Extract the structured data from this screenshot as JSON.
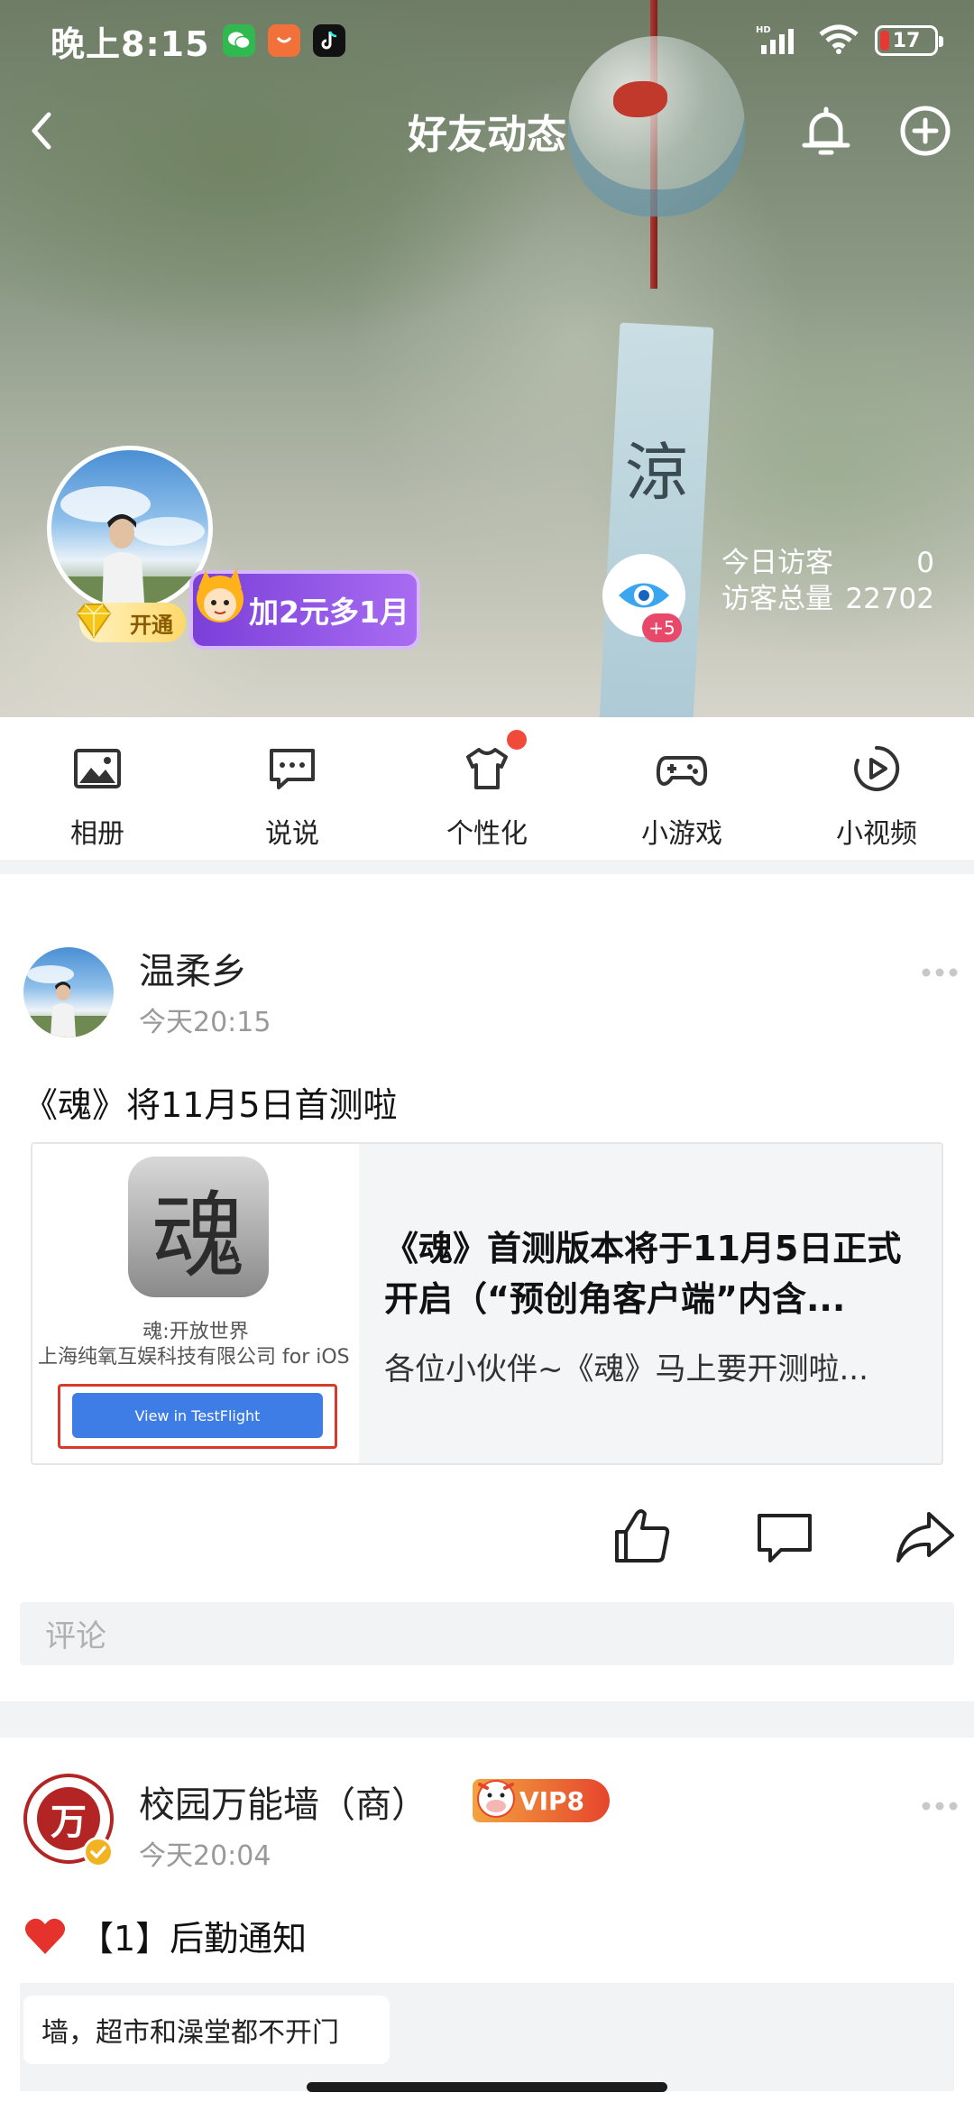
{
  "status_bar": {
    "time": "晚上8:15",
    "network": "HD",
    "battery": "17"
  },
  "nav": {
    "title": "好友动态"
  },
  "cover": {
    "chime_char": "涼",
    "open_badge": "开通",
    "promo": "加2元多1月",
    "visitor_plus": "+5",
    "visitors_today_label": "今日访客",
    "visitors_today": "0",
    "visitors_total_label": "访客总量",
    "visitors_total": "22702"
  },
  "functions": [
    {
      "label": "相册",
      "icon": "photo-album-icon"
    },
    {
      "label": "说说",
      "icon": "message-bubble-icon"
    },
    {
      "label": "个性化",
      "icon": "tshirt-icon",
      "has_dot": true
    },
    {
      "label": "小游戏",
      "icon": "gamepad-icon"
    },
    {
      "label": "小视频",
      "icon": "play-video-icon"
    }
  ],
  "post1": {
    "name": "温柔乡",
    "time": "今天20:15",
    "text": "《魂》将11月5日首测啦",
    "card": {
      "app_icon_char": "魂",
      "app_name": "魂:开放世界",
      "app_dev": "上海纯氧互娱科技有限公司 for iOS",
      "button": "View in TestFlight",
      "title": "《魂》首测版本将于11月5日正式开启（“预创角客户端”内含...",
      "desc": "各位小伙伴~《魂》马上要开测啦..."
    },
    "comment_placeholder": "评论"
  },
  "post2": {
    "avatar_char": "万",
    "name": "校园万能墙（商）",
    "vip": "VIP8",
    "time": "今天20:04",
    "text": "【1】后勤通知",
    "note": "墙，超市和澡堂都不开门"
  },
  "colors": {
    "accent_red": "#f24a3a",
    "promo_purple": "#7a3fd8",
    "testflight_blue": "#3d7de5",
    "vip_orange": "#e6452c",
    "separator_gray": "#f2f3f5"
  }
}
